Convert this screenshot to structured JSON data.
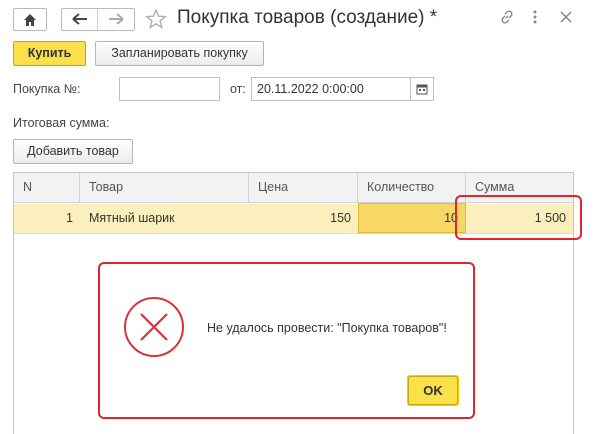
{
  "window": {
    "title": "Покупка товаров (создание) *"
  },
  "toolbar": {
    "buy_label": "Купить",
    "plan_label": "Запланировать покупку",
    "add_item_label": "Добавить товар"
  },
  "form": {
    "number_label": "Покупка №:",
    "number_value": "",
    "date_label": "от:",
    "date_value": "20.11.2022  0:00:00",
    "total_label": "Итоговая сумма:"
  },
  "table": {
    "headers": {
      "n": "N",
      "product": "Товар",
      "price": "Цена",
      "qty": "Количество",
      "sum": "Сумма"
    },
    "rows": [
      {
        "n": "1",
        "product": "Мятный шарик",
        "price": "150",
        "qty": "10",
        "sum": "1 500"
      }
    ]
  },
  "dialog": {
    "message": "Не удалось провести: \"Покупка товаров\"!",
    "ok_label": "OK"
  },
  "colors": {
    "accent": "#fae14a",
    "error": "#e2242b",
    "selected_row": "#fbf0bd"
  },
  "icons": [
    "home-icon",
    "back-arrow-icon",
    "forward-arrow-icon",
    "star-icon",
    "link-icon",
    "more-icon",
    "close-icon",
    "calendar-icon",
    "error-icon"
  ]
}
